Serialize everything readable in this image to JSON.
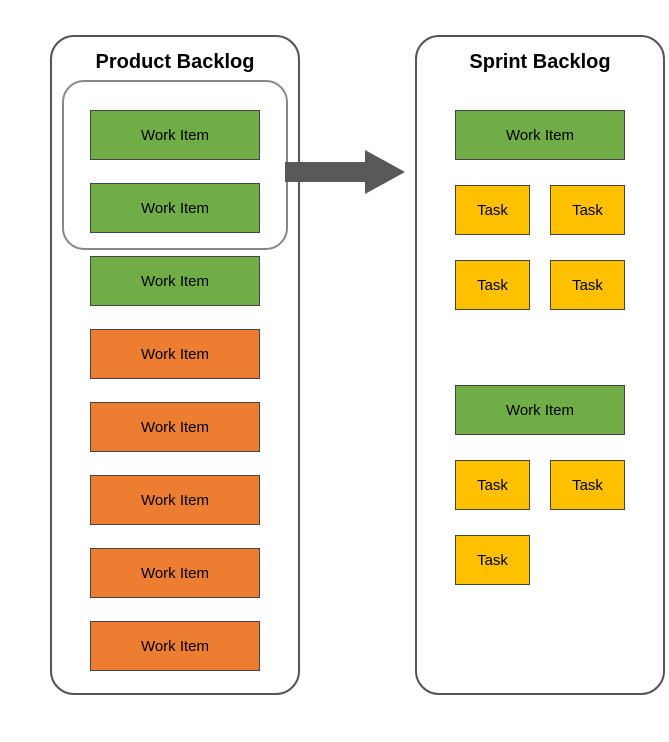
{
  "left": {
    "title": "Product Backlog",
    "items": [
      {
        "label": "Work Item",
        "color": "green",
        "selected": true
      },
      {
        "label": "Work Item",
        "color": "green",
        "selected": true
      },
      {
        "label": "Work Item",
        "color": "green",
        "selected": false
      },
      {
        "label": "Work Item",
        "color": "orange",
        "selected": false
      },
      {
        "label": "Work Item",
        "color": "orange",
        "selected": false
      },
      {
        "label": "Work Item",
        "color": "orange",
        "selected": false
      },
      {
        "label": "Work Item",
        "color": "orange",
        "selected": false
      },
      {
        "label": "Work Item",
        "color": "orange",
        "selected": false
      }
    ]
  },
  "right": {
    "title": "Sprint Backlog",
    "groups": [
      {
        "work_item": "Work Item",
        "tasks": [
          "Task",
          "Task",
          "Task",
          "Task"
        ]
      },
      {
        "work_item": "Work Item",
        "tasks": [
          "Task",
          "Task",
          "Task"
        ]
      }
    ]
  },
  "colors": {
    "green": "#70ad47",
    "orange": "#ed7d31",
    "yellow": "#ffc000",
    "arrow": "#595959"
  }
}
